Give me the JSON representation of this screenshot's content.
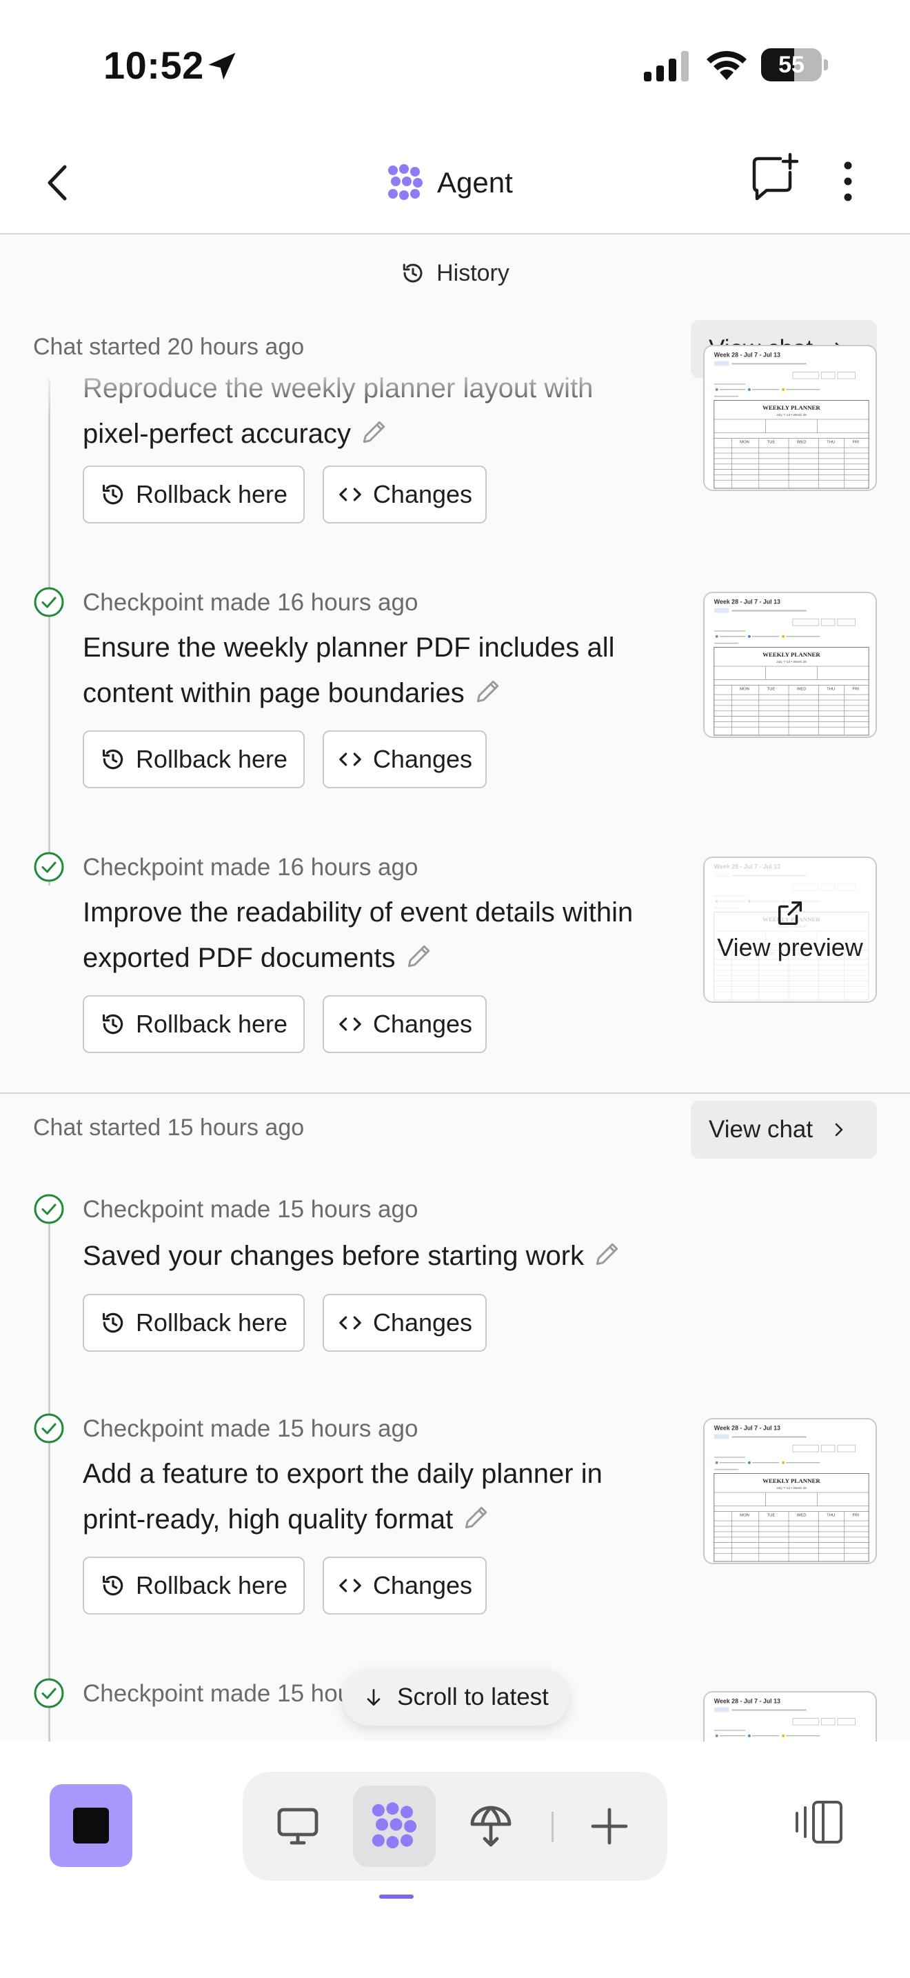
{
  "status_bar": {
    "time": "10:52",
    "battery": "55",
    "battery_level": 0.55
  },
  "header": {
    "title": "Agent"
  },
  "history_label": "History",
  "sections": [
    {
      "chat_started": "Chat started",
      "chat_started_time": "20 hours ago",
      "view_chat_label": "View chat",
      "checkpoints": [
        {
          "meta": "",
          "time": "",
          "title": "Reproduce the weekly planner layout with pixel-perfect accuracy",
          "thumbnail": "weekly-planner"
        },
        {
          "meta": "Checkpoint made",
          "time": "16 hours ago",
          "title": "Ensure the weekly planner PDF includes all content within page boundaries",
          "thumbnail": "weekly-planner"
        },
        {
          "meta": "Checkpoint made",
          "time": "16 hours ago",
          "title": "Improve the readability of event details within exported PDF documents",
          "thumbnail": "weekly-planner-preview"
        }
      ]
    },
    {
      "chat_started": "Chat started",
      "chat_started_time": "15 hours ago",
      "view_chat_label": "View chat",
      "checkpoints": [
        {
          "meta": "Checkpoint made",
          "time": "15 hours ago",
          "title": "Saved your changes before starting work",
          "thumbnail": ""
        },
        {
          "meta": "Checkpoint made",
          "time": "15 hours ago",
          "title": "Add a feature to export the daily planner in print-ready, high quality format",
          "thumbnail": "weekly-planner"
        },
        {
          "meta": "Checkpoint made",
          "time": "15 hours ago",
          "title": "",
          "thumbnail": "weekly-planner"
        }
      ]
    }
  ],
  "buttons": {
    "rollback": "Rollback here",
    "changes": "Changes"
  },
  "preview_label": "View preview",
  "scroll_to_latest": "Scroll to latest",
  "thumbnail_text": {
    "week": "Week 28 - Jul 7 - Jul 13",
    "planner": "WEEKLY PLANNER",
    "range": "July 7-13 • Week 28",
    "days": [
      "MON",
      "TUE",
      "WED",
      "THU",
      "FRI"
    ]
  },
  "colors": {
    "accent": "#7c66f0",
    "stop_button": "#a999ff",
    "check": "#1f8a3a"
  }
}
